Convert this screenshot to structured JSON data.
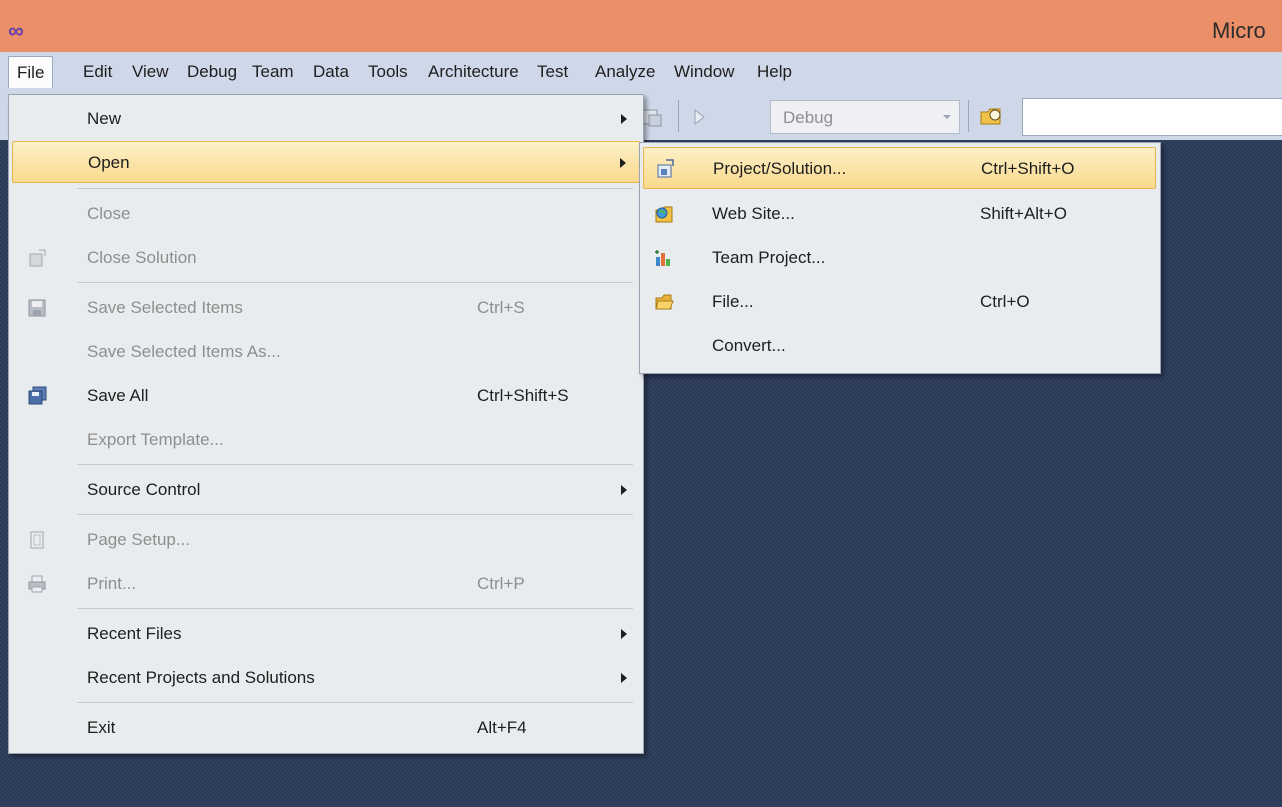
{
  "window": {
    "title": "Micro"
  },
  "menubar": {
    "items": [
      {
        "label": "File"
      },
      {
        "label": "Edit"
      },
      {
        "label": "View"
      },
      {
        "label": "Debug"
      },
      {
        "label": "Team"
      },
      {
        "label": "Data"
      },
      {
        "label": "Tools"
      },
      {
        "label": "Architecture"
      },
      {
        "label": "Test"
      },
      {
        "label": "Analyze"
      },
      {
        "label": "Window"
      },
      {
        "label": "Help"
      }
    ]
  },
  "toolbar": {
    "config_value": "Debug"
  },
  "file_menu": {
    "items": [
      {
        "label": "New",
        "shortcut": "",
        "submenu": true,
        "disabled": false,
        "icon": ""
      },
      {
        "label": "Open",
        "shortcut": "",
        "submenu": true,
        "disabled": false,
        "icon": ""
      },
      {
        "label": "Close",
        "shortcut": "",
        "submenu": false,
        "disabled": true,
        "icon": ""
      },
      {
        "label": "Close Solution",
        "shortcut": "",
        "submenu": false,
        "disabled": true,
        "icon": "close-solution-icon"
      },
      {
        "label": "Save Selected Items",
        "shortcut": "Ctrl+S",
        "submenu": false,
        "disabled": true,
        "icon": "save-icon"
      },
      {
        "label": "Save Selected Items As...",
        "shortcut": "",
        "submenu": false,
        "disabled": true,
        "icon": ""
      },
      {
        "label": "Save All",
        "shortcut": "Ctrl+Shift+S",
        "submenu": false,
        "disabled": false,
        "icon": "save-all-icon"
      },
      {
        "label": "Export Template...",
        "shortcut": "",
        "submenu": false,
        "disabled": true,
        "icon": ""
      },
      {
        "label": "Source Control",
        "shortcut": "",
        "submenu": true,
        "disabled": false,
        "icon": ""
      },
      {
        "label": "Page Setup...",
        "shortcut": "",
        "submenu": false,
        "disabled": true,
        "icon": "page-setup-icon"
      },
      {
        "label": "Print...",
        "shortcut": "Ctrl+P",
        "submenu": false,
        "disabled": true,
        "icon": "print-icon"
      },
      {
        "label": "Recent Files",
        "shortcut": "",
        "submenu": true,
        "disabled": false,
        "icon": ""
      },
      {
        "label": "Recent Projects and Solutions",
        "shortcut": "",
        "submenu": true,
        "disabled": false,
        "icon": ""
      },
      {
        "label": "Exit",
        "shortcut": "Alt+F4",
        "submenu": false,
        "disabled": false,
        "icon": ""
      }
    ]
  },
  "open_submenu": {
    "items": [
      {
        "label": "Project/Solution...",
        "shortcut": "Ctrl+Shift+O",
        "icon": "project-solution-icon"
      },
      {
        "label": "Web Site...",
        "shortcut": "Shift+Alt+O",
        "icon": "web-site-icon"
      },
      {
        "label": "Team Project...",
        "shortcut": "",
        "icon": "team-project-icon"
      },
      {
        "label": "File...",
        "shortcut": "Ctrl+O",
        "icon": "open-file-icon"
      },
      {
        "label": "Convert...",
        "shortcut": "",
        "icon": ""
      }
    ]
  },
  "colors": {
    "titlebar": "#ea8f67",
    "chrome": "#cfd8e9",
    "workspace": "#2b3a58",
    "menu_bg": "#e9ecee",
    "highlight": "#f9d98c"
  }
}
